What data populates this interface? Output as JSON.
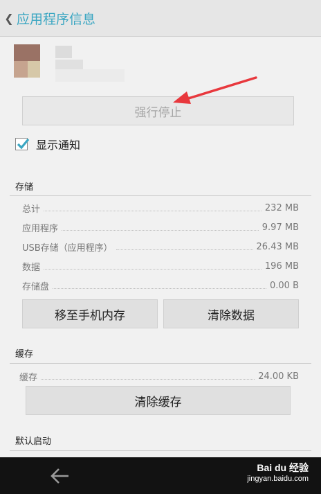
{
  "header": {
    "title": "应用程序信息"
  },
  "app": {
    "force_stop_label": "强行停止"
  },
  "notifications": {
    "label": "显示通知",
    "checked": true
  },
  "storage": {
    "section_title": "存储",
    "rows": [
      {
        "label": "总计",
        "value": "232 MB"
      },
      {
        "label": "应用程序",
        "value": "9.97 MB"
      },
      {
        "label": "USB存储（应用程序）",
        "value": "26.43 MB"
      },
      {
        "label": "数据",
        "value": "196 MB"
      },
      {
        "label": "存储盘",
        "value": "0.00 B"
      }
    ],
    "move_button": "移至手机内存",
    "clear_data_button": "清除数据"
  },
  "cache": {
    "section_title": "缓存",
    "label": "缓存",
    "value": "24.00 KB",
    "clear_cache_button": "清除缓存"
  },
  "launch": {
    "section_title": "默认启动"
  },
  "watermark": {
    "brand": "Bai du 经验",
    "url": "jingyan.baidu.com"
  },
  "colors": {
    "accent": "#3aa6c2",
    "annotation_arrow": "#e8383d",
    "checkbox": "#3aa6c2"
  },
  "icons": [
    "back-chevron-icon",
    "checkbox-check-icon",
    "nav-back-arrow-icon",
    "baidu-paw-icon"
  ]
}
